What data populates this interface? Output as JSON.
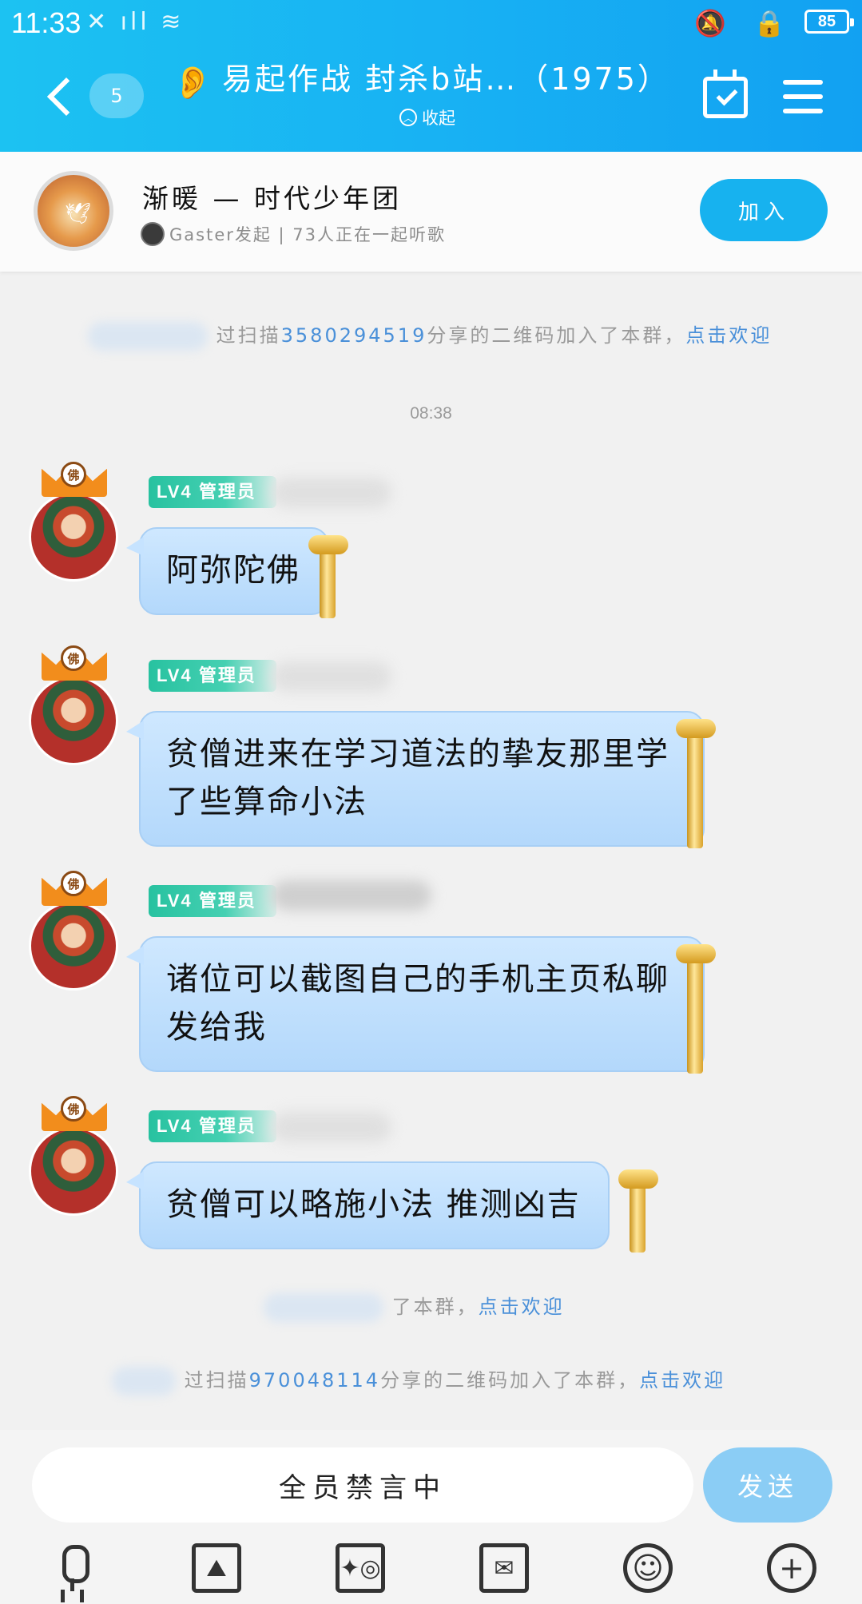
{
  "status_bar": {
    "time": "11:33",
    "left_icons": "✕ ıll ≋",
    "right_icons": "🔕 🔒",
    "battery": "85"
  },
  "header": {
    "unread_count": "5",
    "title": "易起作战 封杀b站…（1975）",
    "collapse_label": "收起",
    "accent_color": "#18b2f3"
  },
  "room": {
    "name": "渐暖 — 时代少年团",
    "subtitle": "Gaster发起 | 73人正在一起听歌",
    "join_label": "加入"
  },
  "chat": {
    "system_messages": [
      {
        "prefix": "过扫描",
        "id": "3580294519",
        "suffix": "分享的二维码加入了本群，",
        "link": "点击欢迎"
      },
      {
        "prefix": "",
        "id": "",
        "suffix": "了本群，",
        "link": "点击欢迎"
      },
      {
        "prefix": "过扫描",
        "id": "970048114",
        "suffix": "分享的二维码加入了本群，",
        "link": "点击欢迎"
      }
    ],
    "timestamp": "08:38",
    "messages": [
      {
        "level": "LV4 管理员",
        "crown_char": "佛",
        "text": "阿弥陀佛"
      },
      {
        "level": "LV4 管理员",
        "crown_char": "佛",
        "text": "贫僧进来在学习道法的挚友那里学了些算命小法"
      },
      {
        "level": "LV4 管理员",
        "crown_char": "佛",
        "text": "诸位可以截图自己的手机主页私聊发给我"
      },
      {
        "level": "LV4 管理员",
        "crown_char": "佛",
        "text": "贫僧可以略施小法 推测凶吉"
      }
    ]
  },
  "input": {
    "muted_text": "全员禁言中",
    "send_label": "发送"
  },
  "toolbar": {
    "icons": [
      "microphone-icon",
      "image-icon",
      "camera-icon",
      "red-packet-icon",
      "emoji-icon",
      "plus-icon"
    ]
  }
}
